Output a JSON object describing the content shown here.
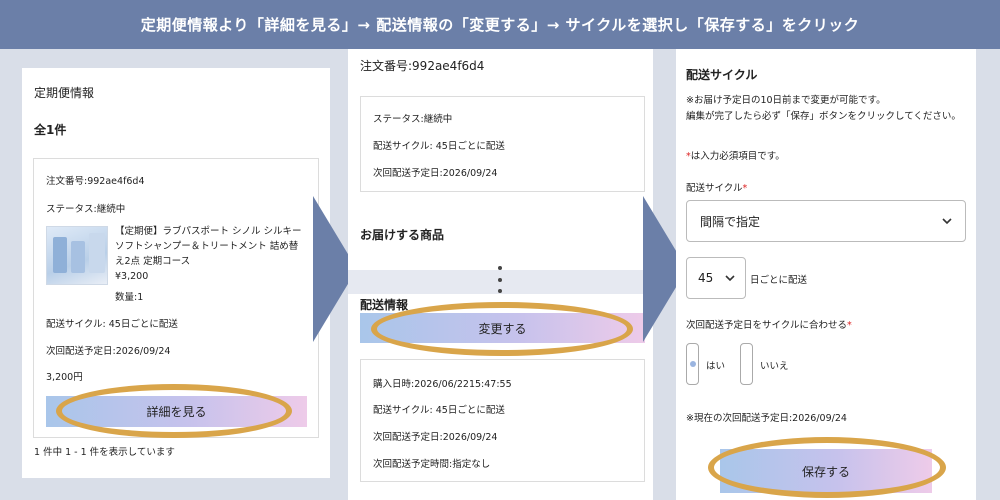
{
  "banner": {
    "text": "定期便情報より「詳細を見る」→ 配送情報の「変更する」→ サイクルを選択し「保存する」をクリック"
  },
  "panel1": {
    "title": "定期便情報",
    "count": "全1件",
    "order_number": "注文番号:992ae4f6d4",
    "status": "ステータス:継続中",
    "product_name": "【定期便】ラブパスポート シノル シルキーソフトシャンプー＆トリートメント 詰め替え2点 定期コース",
    "price": "¥3,200",
    "quantity": "数量:1",
    "cycle": "配送サイクル: 45日ごとに配送",
    "next_date": "次回配送予定日:2026/09/24",
    "total": "3,200円",
    "details_button": "詳細を見る",
    "pagination": "1 件中 1 - 1 件を表示しています"
  },
  "panel2": {
    "order_number": "注文番号:992ae4f6d4",
    "status": "ステータス:継続中",
    "cycle": "配送サイクル: 45日ごとに配送",
    "next_date": "次回配送予定日:2026/09/24",
    "items_heading": "お届けする商品",
    "shipping_heading": "配送情報",
    "change_button": "変更する",
    "purchase_datetime": "購入日時:2026/06/2215:47:55",
    "cycle2": "配送サイクル: 45日ごとに配送",
    "next_date2": "次回配送予定日:2026/09/24",
    "time": "次回配送予定時間:指定なし"
  },
  "panel3": {
    "title": "配送サイクル",
    "note1": "※お届け予定日の10日前まで変更が可能です。",
    "note2": "編集が完了したら必ず「保存」ボタンをクリックしてください。",
    "required_mark": "*",
    "required_note": "は入力必須項目です。",
    "cycle_label": "配送サイクル",
    "cycle_select_value": "間隔で指定",
    "days_value": "45",
    "days_suffix": "日ごとに配送",
    "align_label": "次回配送予定日をサイクルに合わせる",
    "option_yes": "はい",
    "option_no": "いいえ",
    "current_next_date": "※現在の次回配送予定日:2026/09/24",
    "save_button": "保存する"
  },
  "colors": {
    "banner": "#6b7fa8",
    "arrow": "#6b7fa8",
    "highlight": "#d9a54a"
  },
  "icons": {
    "select": "chevron-down-icon",
    "more": "vertical-dots-icon"
  }
}
